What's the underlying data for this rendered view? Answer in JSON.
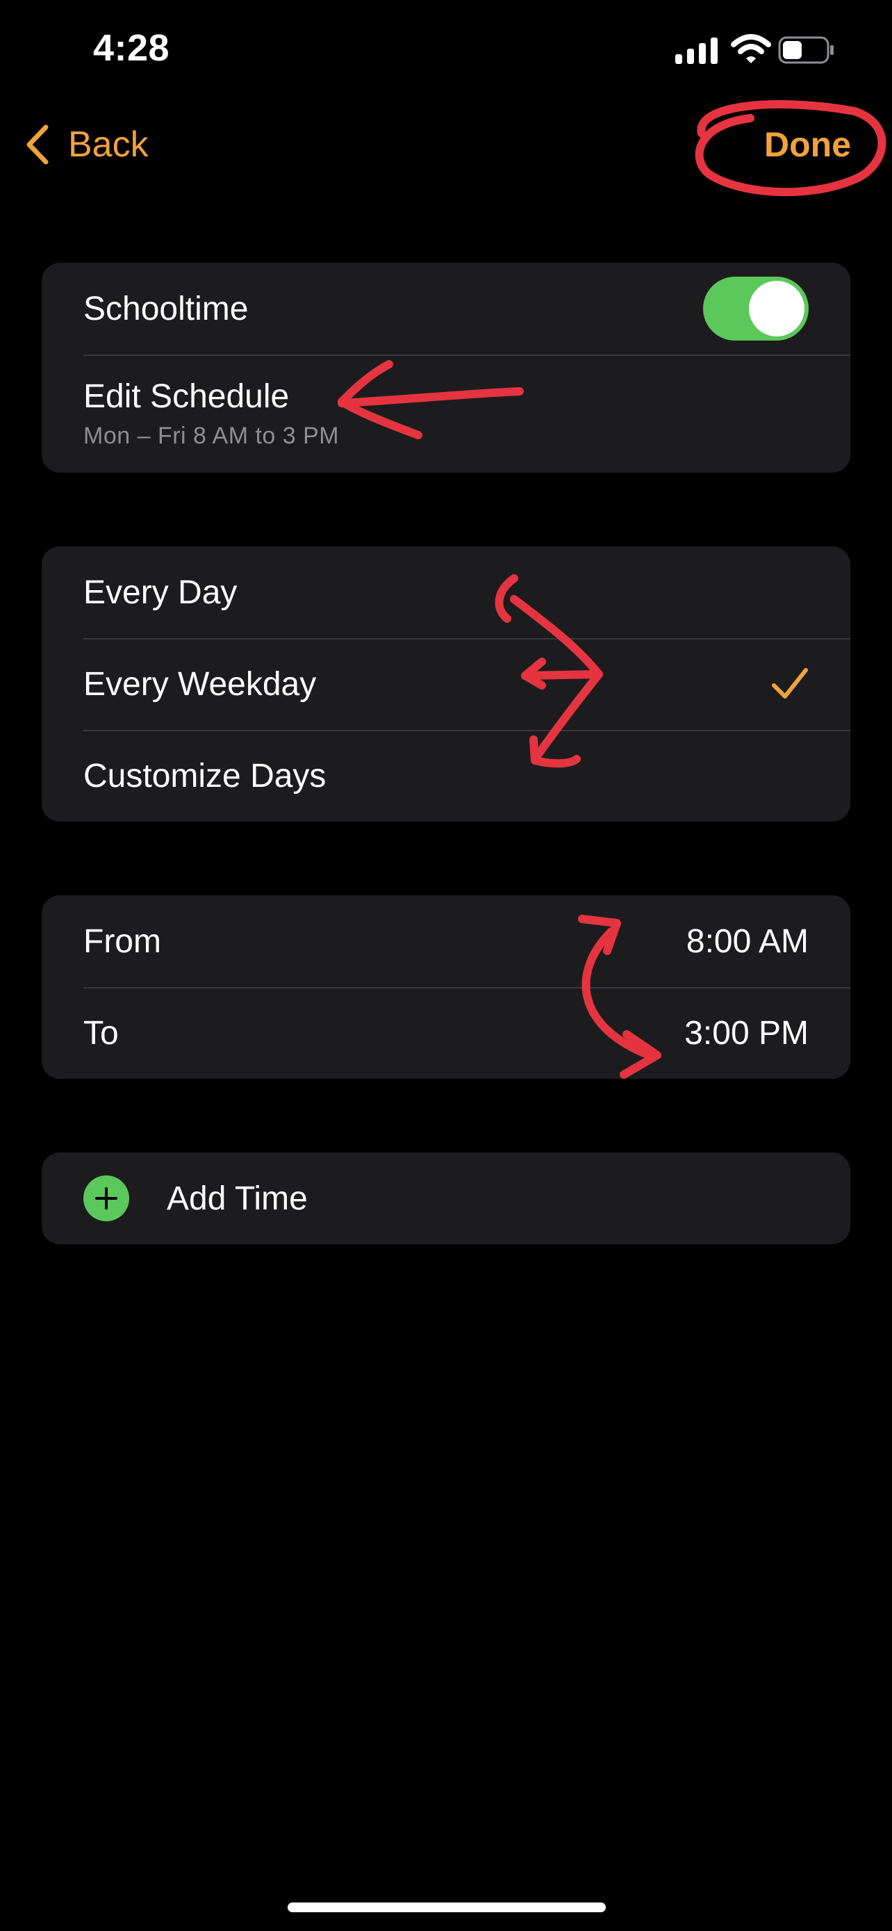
{
  "status_bar": {
    "time": "4:28",
    "icons": [
      "cellular-signal-icon",
      "wifi-icon",
      "battery-icon"
    ],
    "battery_level": 0.45
  },
  "nav": {
    "back_label": "Back",
    "done_label": "Done"
  },
  "schedule_card": {
    "toggle_label": "Schooltime",
    "toggle_on": true,
    "edit_label": "Edit Schedule",
    "edit_subtitle": "Mon – Fri 8 AM to 3 PM"
  },
  "repeat_options": [
    {
      "label": "Every Day",
      "selected": false
    },
    {
      "label": "Every Weekday",
      "selected": true
    },
    {
      "label": "Customize Days",
      "selected": false
    }
  ],
  "time_range": {
    "from_label": "From",
    "from_value": "8:00 AM",
    "to_label": "To",
    "to_value": "3:00 PM"
  },
  "add_time": {
    "label": "Add Time",
    "icon": "plus-circle-icon"
  },
  "colors": {
    "accent": "#f0a23c",
    "toggle_on": "#5ac85a",
    "card_bg": "#1c1c1e",
    "annotation": "#e5343f"
  }
}
